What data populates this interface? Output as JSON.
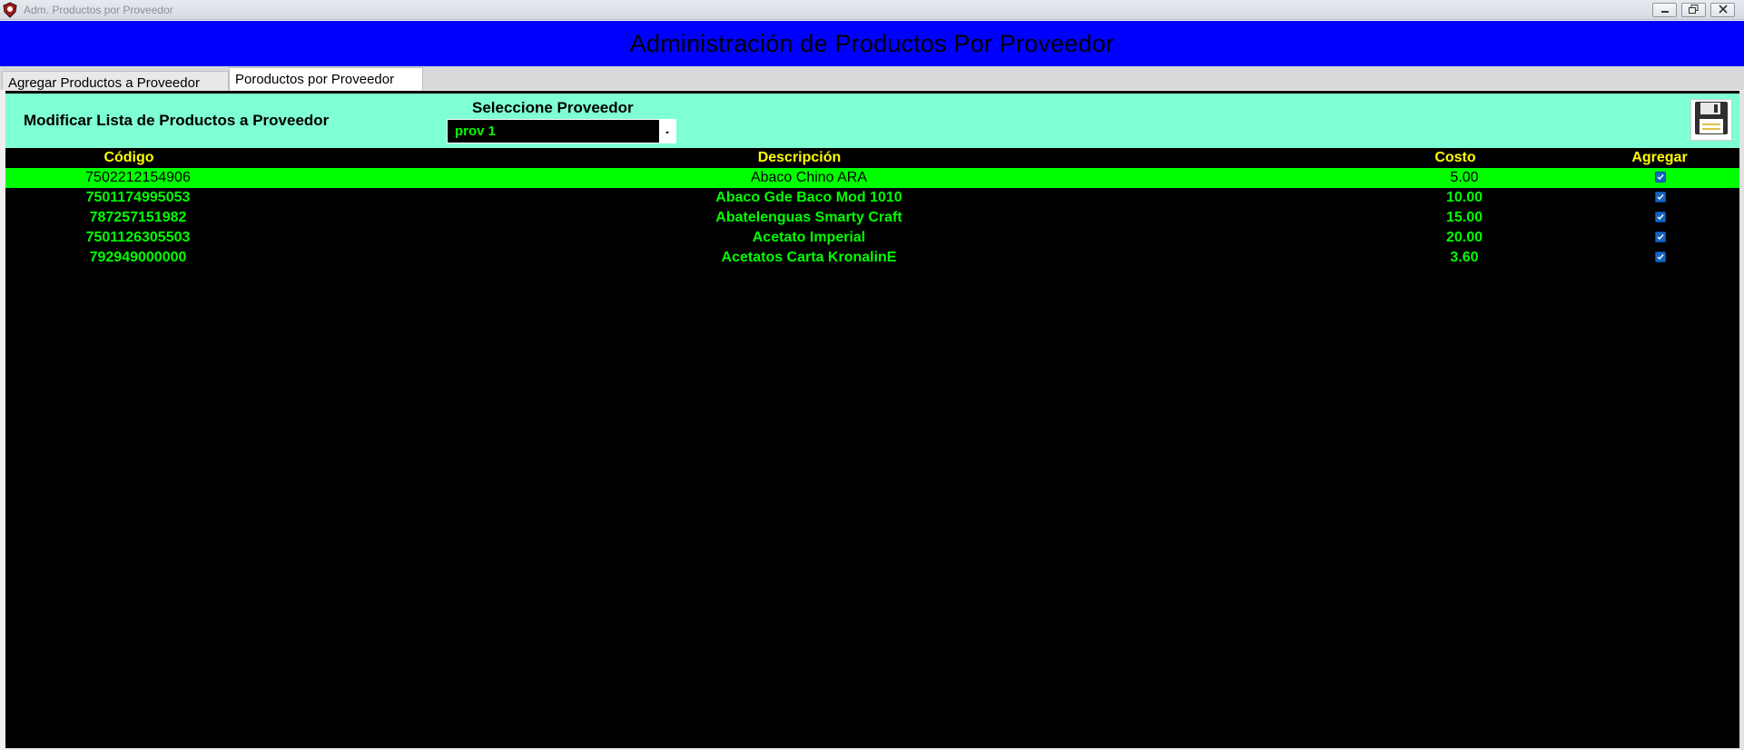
{
  "window": {
    "title": "Adm. Productos por Proveedor",
    "icon": "app-shield-icon"
  },
  "header": {
    "title": "Administración de Productos Por Proveedor",
    "background": "#0000ff"
  },
  "tabs": [
    {
      "label": "Agregar Productos a Proveedor",
      "active": false
    },
    {
      "label": "Poroductos por Proveedor",
      "active": true
    }
  ],
  "toolbar": {
    "title": "Modificar Lista de Productos a Proveedor",
    "selector_label": "Seleccione Proveedor",
    "selected_provider": "prov 1",
    "save_icon": "floppy-disk-icon",
    "background": "#7fffd4"
  },
  "grid": {
    "columns": [
      "Código",
      "Descripción",
      "Costo",
      "Agregar"
    ],
    "rows": [
      {
        "codigo": "7502212154906",
        "descripcion": "Abaco Chino ARA",
        "costo": "5.00",
        "agregar": true,
        "selected": true
      },
      {
        "codigo": "7501174995053",
        "descripcion": "Abaco Gde Baco Mod 1010",
        "costo": "10.00",
        "agregar": true,
        "selected": false
      },
      {
        "codigo": "787257151982",
        "descripcion": "Abatelenguas Smarty Craft",
        "costo": "15.00",
        "agregar": true,
        "selected": false
      },
      {
        "codigo": "7501126305503",
        "descripcion": "Acetato Imperial",
        "costo": "20.00",
        "agregar": true,
        "selected": false
      },
      {
        "codigo": "792949000000",
        "descripcion": "Acetatos Carta KronalinE",
        "costo": "3.60",
        "agregar": true,
        "selected": false
      }
    ],
    "header_color": "#ffff00",
    "text_color": "#00ff00",
    "selected_color": "#00ff00"
  }
}
